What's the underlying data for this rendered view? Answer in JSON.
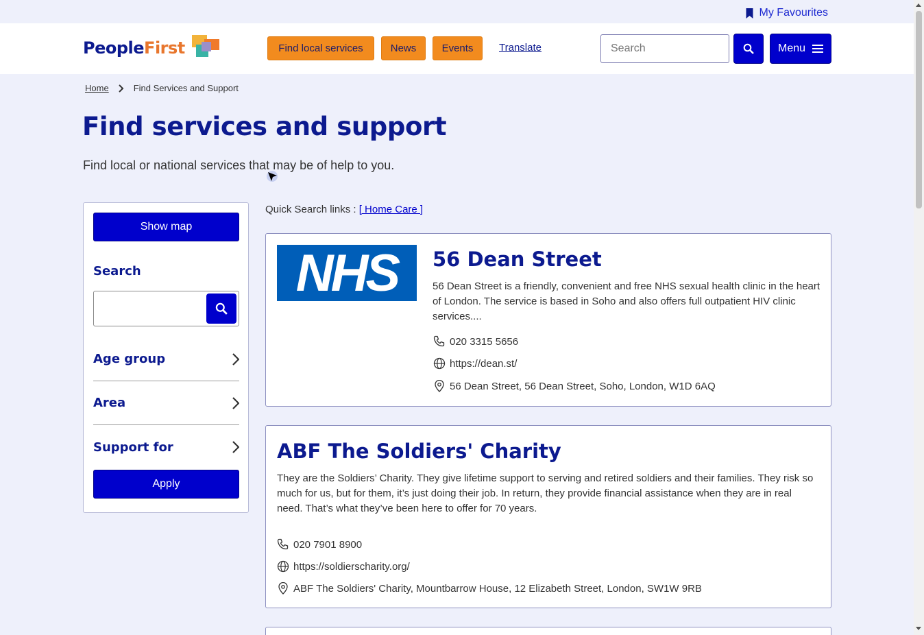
{
  "topbar": {
    "favourites_label": "My Favourites"
  },
  "header": {
    "logo": {
      "people": "People",
      "first": "First"
    },
    "nav": [
      {
        "label": "Find local services"
      },
      {
        "label": "News"
      },
      {
        "label": "Events"
      }
    ],
    "translate_label": "Translate",
    "search_placeholder": "Search",
    "menu_label": "Menu"
  },
  "breadcrumb": {
    "home": "Home",
    "current": "Find Services and Support"
  },
  "page": {
    "title": "Find services and support",
    "subtitle": "Find local or national services that may be of help to you."
  },
  "filters": {
    "show_map": "Show map",
    "search_label": "Search",
    "search_value": "",
    "groups": [
      "Age group",
      "Area",
      "Support for"
    ],
    "apply": "Apply"
  },
  "quick_search": {
    "prefix": "Quick Search links : ",
    "link": "[ Home Care ]"
  },
  "results": [
    {
      "logo_text": "NHS",
      "title": "56 Dean Street",
      "description": "56 Dean Street is a friendly, convenient and free NHS sexual health clinic in the heart of London. The service is based in Soho and also offers full outpatient HIV clinic services....",
      "phone": "020 3315 5656",
      "website": "https://dean.st/",
      "address": "56 Dean Street, 56 Dean Street, Soho, London, W1D 6AQ"
    },
    {
      "title": "ABF The Soldiers' Charity",
      "description": "They are the Soldiers’ Charity. They give lifetime support to serving and retired soldiers and their families. They risk so much for us, but for them, it’s just doing their job. In return, they provide financial assistance when they are in real need. That’s what they’ve been here to offer for 70 years.",
      "phone": "020 7901 8900",
      "website": "https://soldierscharity.org/",
      "address": "ABF The Soldiers' Charity, Mountbarrow House, 12 Elizabeth Street, London, SW1W 9RB"
    }
  ],
  "colors": {
    "primary": "#0000cc",
    "accent": "#f28b1e",
    "heading": "#0c1a8f",
    "background": "#eef0fb"
  }
}
